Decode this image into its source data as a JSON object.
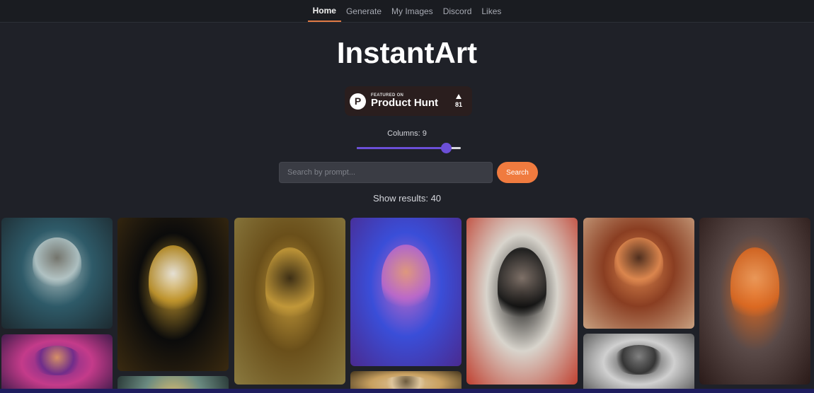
{
  "nav": {
    "items": [
      {
        "label": "Home",
        "active": true
      },
      {
        "label": "Generate",
        "active": false
      },
      {
        "label": "My Images",
        "active": false
      },
      {
        "label": "Discord",
        "active": false
      },
      {
        "label": "Likes",
        "active": false
      }
    ]
  },
  "hero": {
    "title": "InstantArt"
  },
  "product_hunt": {
    "logo_letter": "P",
    "featured_text": "FEATURED ON",
    "name": "Product Hunt",
    "votes": "81"
  },
  "columns": {
    "label": "Columns: 9",
    "value": 9,
    "fraction": 0.86
  },
  "search": {
    "placeholder": "Search by prompt...",
    "button_label": "Search"
  },
  "results": {
    "label": "Show results: 40"
  },
  "colors": {
    "accent_orange": "#f07b3f",
    "slider_purple": "#6b4fd8",
    "background": "#1f2128"
  },
  "gallery": {
    "images": [
      {
        "subject": "tabby cat",
        "colors": [
          "#2e5a68",
          "#b8c8c8",
          "#6d6a60",
          "#1d2a30"
        ]
      },
      {
        "subject": "pink sculpted face",
        "colors": [
          "#c43b8a",
          "#6a2c8a",
          "#e6a060",
          "#2a1640"
        ]
      },
      {
        "subject": "gold skull in suit",
        "colors": [
          "#0b0b0b",
          "#c79a2e",
          "#f2f2f2",
          "#3a2a10"
        ]
      },
      {
        "subject": "figure with gold rays",
        "colors": [
          "#6a4f1a",
          "#c49a3a",
          "#2a2010",
          "#8a7a40"
        ]
      },
      {
        "subject": "woman with crystal crown",
        "colors": [
          "#3a4ed8",
          "#c06ac8",
          "#e8a070",
          "#4a2a90"
        ]
      },
      {
        "subject": "portrait with blonde hair",
        "colors": [
          "#c8a060",
          "#e0c8a0",
          "#5a4a30",
          "#2a2010"
        ]
      },
      {
        "subject": "cyberpunk woman",
        "colors": [
          "#d8d4cc",
          "#0a0a0a",
          "#8a7a70",
          "#c04030"
        ]
      },
      {
        "subject": "woman with orange headdress",
        "colors": [
          "#8a3e22",
          "#e08a50",
          "#3a2218",
          "#c8a080"
        ]
      },
      {
        "subject": "monochrome portrait",
        "colors": [
          "#d0d0d0",
          "#2a2a2a",
          "#8a8a8a",
          "#4a4a4a"
        ]
      },
      {
        "subject": "woman with autumn leaves",
        "colors": [
          "#5a4a48",
          "#e06a20",
          "#f0a060",
          "#2a1a18"
        ]
      }
    ]
  }
}
